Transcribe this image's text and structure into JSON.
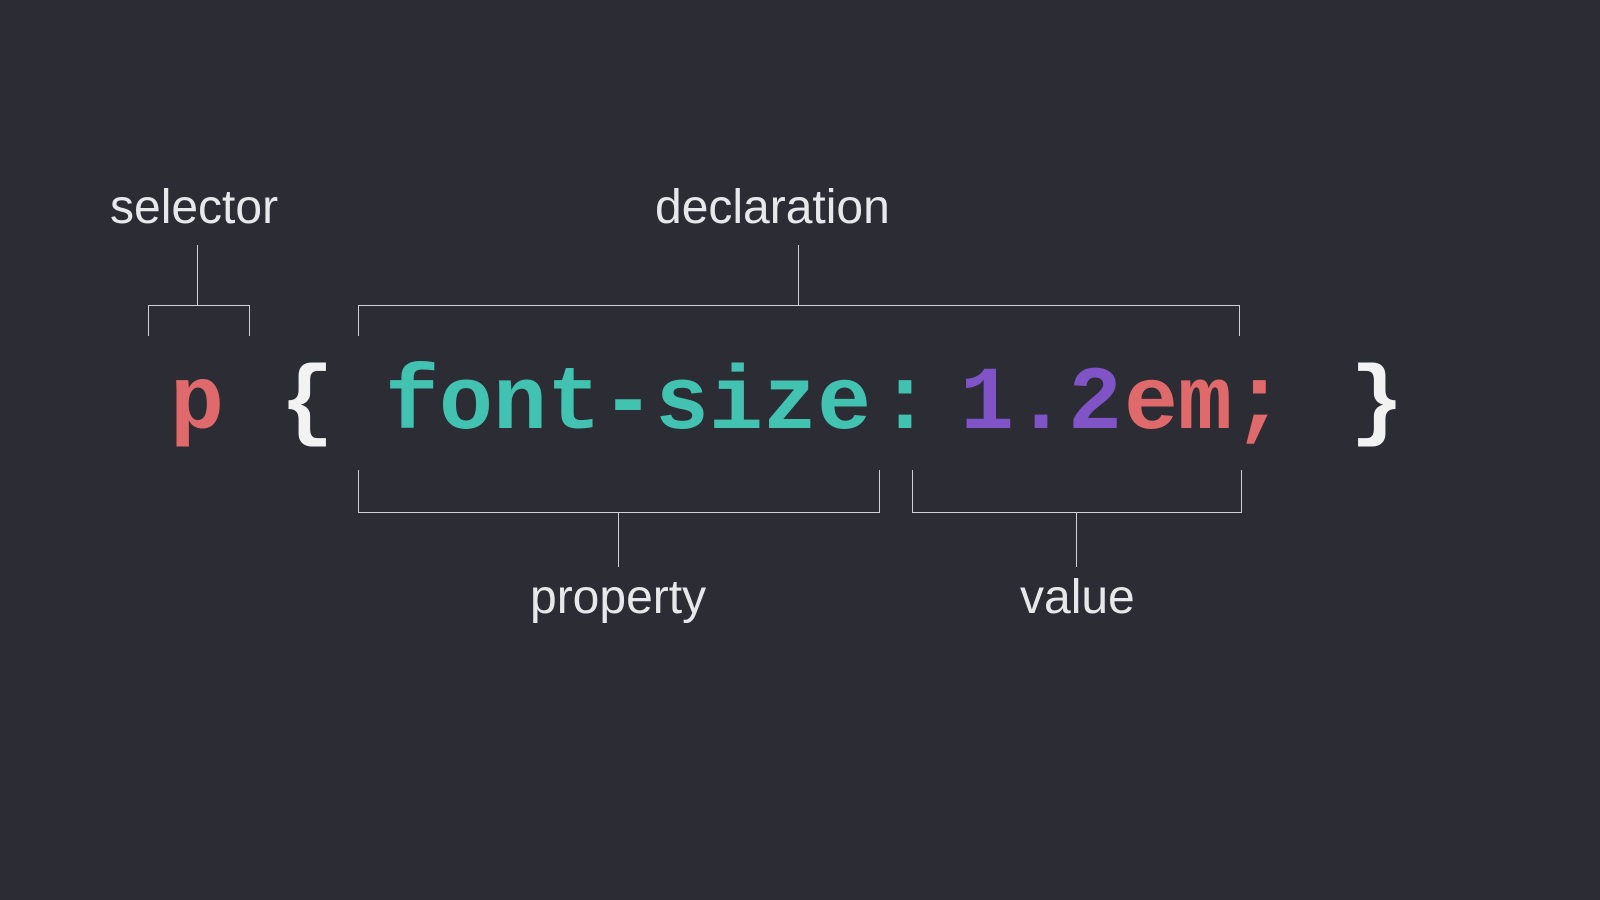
{
  "labels": {
    "selector": "selector",
    "declaration": "declaration",
    "property": "property",
    "value": "value"
  },
  "code": {
    "selector": "p",
    "open_brace": "{",
    "property": "font-size",
    "colon": ":",
    "value_number": "1.2",
    "value_unit": "em",
    "semicolon": ";",
    "close_brace": "}"
  },
  "colors": {
    "background": "#2b2c34",
    "selector": "#e06a6b",
    "brace": "#f2f2f2",
    "property": "#42c2b0",
    "number": "#8053c7",
    "unit": "#e06a6b",
    "label_text": "#e7e8ea",
    "bracket": "#d0d1d4"
  }
}
